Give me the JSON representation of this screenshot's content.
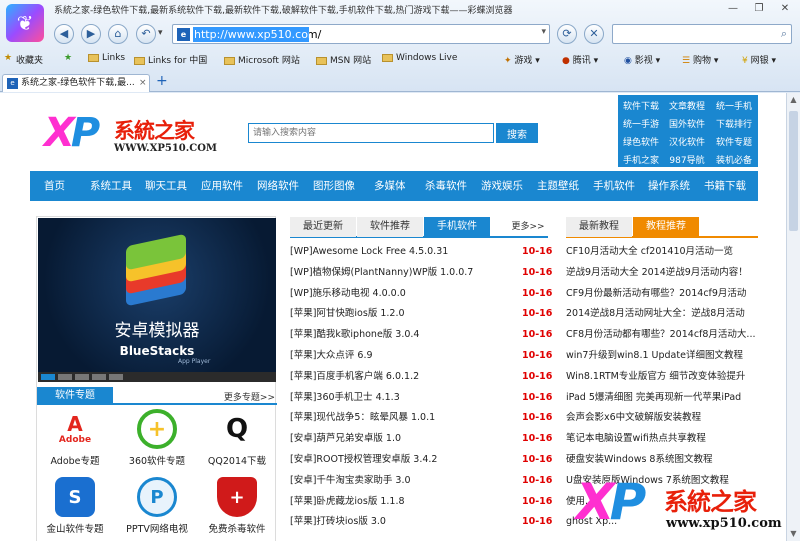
{
  "window": {
    "title": "系統之家-绿色软件下载,最新系统软件下载,最新软件下载,破解软件下载,手机软件下载,热门游戏下载——彩蝶浏览器",
    "address": "http://www.xp510.com/",
    "address_favicon": "e",
    "tab_title": "系统之家-绿色软件下载,最...",
    "tab_close": "×",
    "tab_new": "+"
  },
  "bookmarks": {
    "favorites": "收藏夹",
    "items": [
      "Links",
      "Links for 中国",
      "Microsoft 网站",
      "MSN 网站",
      "Windows Live"
    ],
    "right": [
      "游戏",
      "腾讯",
      "影视",
      "购物",
      "网银"
    ]
  },
  "site": {
    "logo_xp_x": "X",
    "logo_xp_p": "P",
    "logo_cn": "系統之家",
    "logo_url": "WWW.XP510.COM",
    "search_placeholder": "请输入搜索内容",
    "search_button": "搜索",
    "quick_links": [
      "软件下载",
      "文章教程",
      "统一手机",
      "统一手游",
      "国外软件",
      "下载排行",
      "绿色软件",
      "汉化软件",
      "软件专题",
      "手机之家",
      "987导航",
      "装机必备"
    ],
    "nav": [
      "首页",
      "系统工具",
      "聊天工具",
      "应用软件",
      "网络软件",
      "图形图像",
      "多媒体",
      "杀毒软件",
      "游戏娱乐",
      "主题壁纸",
      "手机软件",
      "操作系统",
      "书籍下载"
    ]
  },
  "banner": {
    "title": "安卓模拟器",
    "brand": "BlueStacks",
    "sub": "App Player"
  },
  "topics": {
    "header": "软件专题",
    "more": "更多专题>>",
    "apps": [
      {
        "name": "Adobe专题",
        "glyph": "A",
        "color": "#e3261e",
        "bg": "#ffffff",
        "fg": "#e3261e"
      },
      {
        "name": "360软件专题",
        "glyph": "+",
        "color": "#3cb02b",
        "bg": "#ffffff",
        "fg": "#3cb02b"
      },
      {
        "name": "QQ2014下载",
        "glyph": "Q",
        "color": "#111111",
        "bg": "#ffffff",
        "fg": "#111111"
      },
      {
        "name": "金山软件专题",
        "glyph": "S",
        "color": "#1a6fd0",
        "bg": "#1a6fd0",
        "fg": "#ffffff"
      },
      {
        "name": "PPTV网络电视",
        "glyph": "P",
        "color": "#1a87d0",
        "bg": "#e8f3fc",
        "fg": "#1a87d0"
      },
      {
        "name": "免费杀毒软件",
        "glyph": "+",
        "color": "#d01a1a",
        "bg": "#d01a1a",
        "fg": "#ffffff"
      }
    ],
    "adobe_word": "Adobe"
  },
  "middle": {
    "tabs": [
      "最近更新",
      "软件推荐",
      "手机软件"
    ],
    "active_tab": 2,
    "more": "更多>>",
    "rows": [
      {
        "title": "[WP]Awesome Lock Free 4.5.0.31",
        "date": "10-16"
      },
      {
        "title": "[WP]植物保姆(PlantNanny)WP版 1.0.0.7",
        "date": "10-16"
      },
      {
        "title": "[WP]施乐移动电视 4.0.0.0",
        "date": "10-16"
      },
      {
        "title": "[苹果]阿甘快跑ios版 1.2.0",
        "date": "10-16"
      },
      {
        "title": "[苹果]酷我k歌iphone版 3.0.4",
        "date": "10-16"
      },
      {
        "title": "[苹果]大众点评 6.9",
        "date": "10-16"
      },
      {
        "title": "[苹果]百度手机客户端 6.0.1.2",
        "date": "10-16"
      },
      {
        "title": "[苹果]360手机卫士 4.1.3",
        "date": "10-16"
      },
      {
        "title": "[苹果]现代战争5：眩晕风暴 1.0.1",
        "date": "10-16"
      },
      {
        "title": "[安卓]葫芦兄弟安卓版 1.0",
        "date": "10-16"
      },
      {
        "title": "[安卓]ROOT授权管理安卓版 3.4.2",
        "date": "10-16"
      },
      {
        "title": "[安卓]千牛淘宝卖家助手 3.0",
        "date": "10-16"
      },
      {
        "title": "[苹果]卧虎藏龙ios版 1.1.8",
        "date": "10-16"
      },
      {
        "title": "[苹果]打砖块ios版 3.0",
        "date": "10-16"
      }
    ]
  },
  "right": {
    "tabs": [
      "最新教程",
      "教程推荐"
    ],
    "active_tab": 1,
    "rows": [
      "CF10月活动大全 cf201410月活动一览",
      "逆战9月活动大全 2014逆战9月活动内容！",
      "CF9月份最新活动有哪些？2014cf9月活动",
      "2014逆战8月活动网址大全：逆战8月活动",
      "CF8月份活动都有哪些？2014cf8月活动大...",
      "win7升级到win8.1 Update详细图文教程",
      "Win8.1RTM专业版官方 细节改变体验提升",
      "iPad 5爆清细图 完美再现新一代苹果iPad",
      "会声会影x6中文破解版安装教程",
      "笔记本电脑设置wifi热点共享教程",
      "硬盘安装Windows 8系统图文教程",
      "U盘安装原版Windows 7系统图文教程",
      "使用...",
      "ghost Xp..."
    ]
  },
  "watermark": {
    "xp_x": "X",
    "xp_p": "P",
    "cn": "系統之家",
    "url": "www.xp510.com"
  },
  "icons": {
    "back": "◀",
    "forward": "▶",
    "home": "⌂",
    "undo": "↶",
    "refresh": "⟳",
    "stop": "✕",
    "search": "⌕",
    "minimize": "—",
    "restore": "❐",
    "close": "✕",
    "star": "★",
    "dropdown": "▾"
  },
  "colors": {
    "accent": "#1a87d0",
    "orange": "#f08a00",
    "date_red": "#e00000"
  }
}
